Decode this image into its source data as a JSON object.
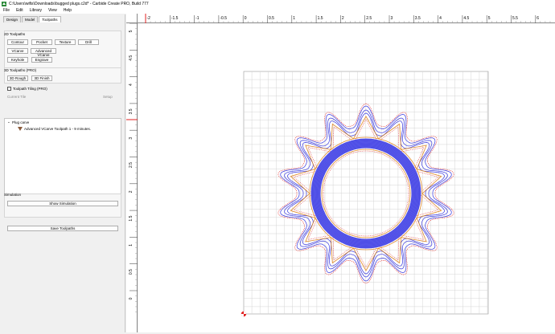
{
  "window": {
    "title": "C:\\Users\\wifis\\Downloads\\bugged plugs.c2d* - Carbide Create PRO, Build 777",
    "icon": "carbide-create-app-icon"
  },
  "menu": [
    "File",
    "Edit",
    "Library",
    "View",
    "Help"
  ],
  "tabs": [
    "Design",
    "Model",
    "Toolpaths"
  ],
  "active_tab": "Toolpaths",
  "toolpaths_2d": {
    "title": "2D Toolpaths",
    "buttons": [
      "Contour",
      "Pocket",
      "Texture",
      "Drill",
      "VCarve",
      "Advanced VCarve",
      "Keyhole",
      "Engrave"
    ]
  },
  "toolpaths_3d": {
    "title": "3D Toolpaths (PRO)",
    "buttons": [
      "3D Rough",
      "3D Finish"
    ]
  },
  "tiling": {
    "label": "Toolpath Tiling (PRO)",
    "current_tile_label": "Current Tile",
    "setup_label": "Setup"
  },
  "tree": {
    "group": "Plug carve",
    "items": [
      "Advanced VCarve Toolpath 1 - 9 minutes."
    ]
  },
  "simulation": {
    "title": "Simulation",
    "show_button": "Show Simulation"
  },
  "save_button": "Save Toolpaths",
  "ruler": {
    "top_ticks": [
      "-2",
      "-1.5",
      "-1",
      "-0.5",
      "0",
      "0.5",
      "1",
      "1.5",
      "2",
      "2.5",
      "3",
      "3.5",
      "4",
      "4.5",
      "5",
      "5.5",
      "6"
    ],
    "left_ticks": [
      "5",
      "4.5",
      "4",
      "3.5",
      "3",
      "2.5",
      "2",
      "1.5",
      "1",
      "0.5",
      "0"
    ]
  },
  "colors": {
    "accent_red": "#e02020",
    "toolpath_blue": "#3a3adf",
    "fill_blue": "#5b5bea",
    "outline_orange": "#e08a2a",
    "grid": "#d4d4d4"
  }
}
